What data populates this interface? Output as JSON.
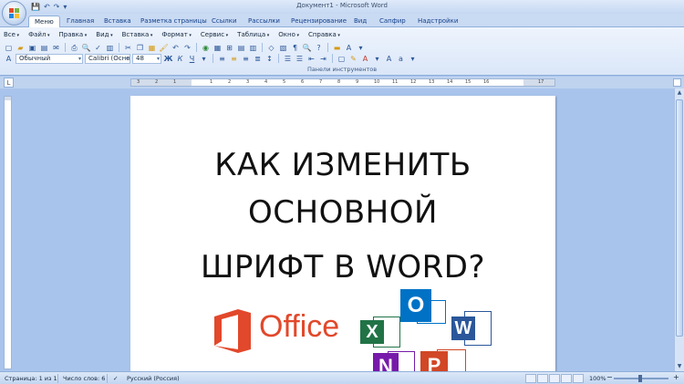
{
  "window": {
    "title": "Документ1 - Microsoft Word"
  },
  "tabs": [
    {
      "label": "Меню",
      "active": true
    },
    {
      "label": "Главная"
    },
    {
      "label": "Вставка"
    },
    {
      "label": "Разметка страницы"
    },
    {
      "label": "Ссылки"
    },
    {
      "label": "Рассылки"
    },
    {
      "label": "Рецензирование"
    },
    {
      "label": "Вид"
    },
    {
      "label": "Сапфир"
    },
    {
      "label": "Надстройки"
    }
  ],
  "menus": [
    "Все",
    "Файл",
    "Правка",
    "Вид",
    "Вставка",
    "Формат",
    "Сервис",
    "Таблица",
    "Окно",
    "Справка"
  ],
  "format": {
    "style": "Обычный",
    "font": "Calibri (Осно",
    "size": "48"
  },
  "ribbon": {
    "panel_label": "Панели инструментов"
  },
  "ruler": {
    "ticks": [
      "3",
      "2",
      "1",
      "1",
      "2",
      "3",
      "4",
      "5",
      "6",
      "7",
      "8",
      "9",
      "10",
      "11",
      "12",
      "13",
      "14",
      "15",
      "16",
      "17"
    ]
  },
  "document": {
    "line1": "КАК ИЗМЕНИТЬ",
    "line2": "ОСНОВНОЙ",
    "line3": "ШРИФТ В WORD?",
    "logo_text": "Office",
    "apps": {
      "excel": "X",
      "outlook": "O",
      "word": "W",
      "onenote": "N",
      "powerpoint": "P"
    }
  },
  "status": {
    "page": "Страница: 1 из 1",
    "words": "Число слов: 6",
    "language": "Русский (Россия)",
    "zoom": "100%"
  },
  "colors": {
    "office_logo": "#e2482b",
    "excel": "#217346",
    "outlook": "#0072c6",
    "word": "#2b579a",
    "onenote": "#7719aa",
    "powerpoint": "#d24726"
  }
}
